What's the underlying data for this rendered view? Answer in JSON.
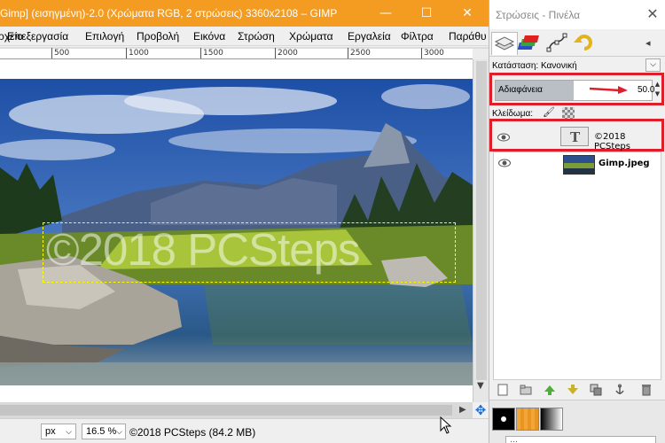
{
  "window": {
    "title": "Gimp] (εισηγμένη)-2.0 (Χρώματα RGB, 2 στρώσεις) 3360x2108 – GIMP",
    "minimize": "—",
    "maximize": "☐",
    "close": "✕"
  },
  "menu": [
    "Αρχείο",
    "Επεξεργασία",
    "Επιλογή",
    "Προβολή",
    "Εικόνα",
    "Στρώση",
    "Χρώματα",
    "Εργαλεία",
    "Φίλτρα",
    "Παράθυ"
  ],
  "ruler": {
    "labels": [
      "500",
      "1000",
      "1500",
      "2000",
      "2500",
      "3000"
    ]
  },
  "canvas": {
    "watermark_text": "©2018 PCSteps"
  },
  "status": {
    "unit": "px",
    "zoom": "16.5 %",
    "message": "©2018 PCSteps (84.2 MB)"
  },
  "layers_dock": {
    "title": "Στρώσεις - Πινέλα",
    "close": "✕",
    "mode_label": "Κατάσταση: Κανονική",
    "opacity_label": "Αδιαφάνεια",
    "opacity_value": "50.0",
    "opacity_fraction": 0.5,
    "lock_label": "Κλείδωμα:",
    "layers": [
      {
        "name": "©2018 PCSteps",
        "type": "text",
        "visible": true
      },
      {
        "name": "Gimp.jpeg",
        "type": "image",
        "visible": true
      }
    ],
    "tool_input_placeholder": "…"
  },
  "colors": {
    "title_bar": "#f49b22",
    "highlight": "#e01d2a",
    "opacity_fill": "#b9bfc5"
  },
  "icons": {
    "layers_tab": "layers-icon",
    "channels_tab": "channels-icon",
    "paths_tab": "paths-icon",
    "undo_tab": "undo-history-icon",
    "lock_paint": "paintbrush-icon",
    "lock_alpha": "checkerboard-icon"
  }
}
